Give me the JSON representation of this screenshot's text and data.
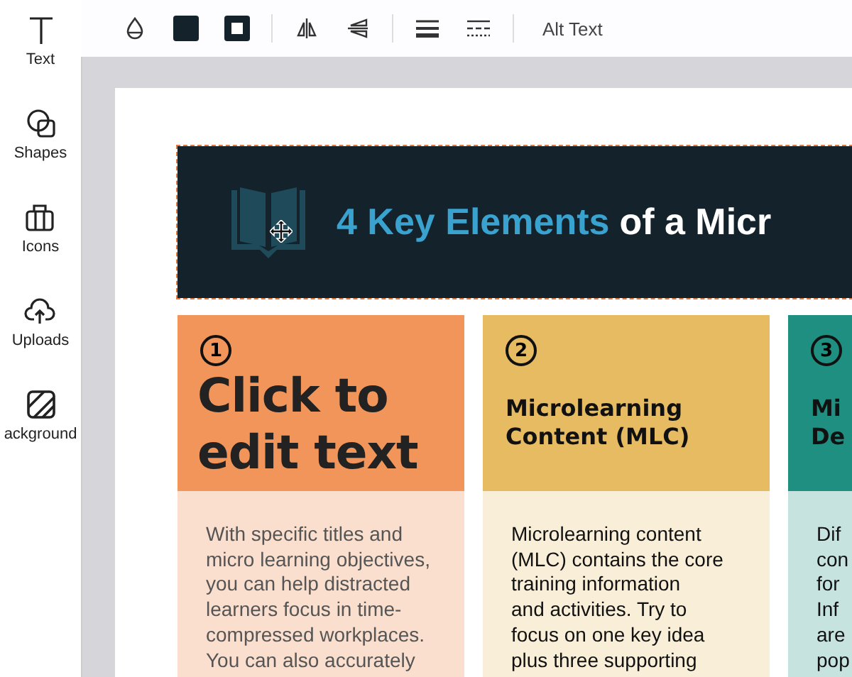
{
  "sidebar": {
    "items": [
      {
        "label": "Text",
        "kind": "text"
      },
      {
        "label": "Shapes",
        "kind": "shapes"
      },
      {
        "label": "Icons",
        "kind": "icons"
      },
      {
        "label": "Uploads",
        "kind": "uploads"
      },
      {
        "label": "ackground",
        "kind": "background"
      }
    ]
  },
  "toolbar": {
    "items": [
      {
        "kind": "opacity"
      },
      {
        "kind": "fill"
      },
      {
        "kind": "border"
      },
      {
        "kind": "divider"
      },
      {
        "kind": "flip-h"
      },
      {
        "kind": "flip-v"
      },
      {
        "kind": "divider"
      },
      {
        "kind": "line-weight"
      },
      {
        "kind": "line-style"
      },
      {
        "kind": "divider"
      },
      {
        "kind": "text",
        "label": "Alt Text"
      }
    ]
  },
  "canvas": {
    "header": {
      "title_highlight": "4 Key Elements",
      "title_rest": "of a Micr",
      "selected": true
    },
    "cards": [
      {
        "number": "1",
        "kind": "placeholder",
        "title": "Click to\nedit text",
        "color": "#f2955a",
        "body": "With specific titles and\nmicro learning objectives,\nyou can help distracted\nlearners focus in time-\ncompressed workplaces.\nYou can also accurately"
      },
      {
        "number": "2",
        "kind": "heading",
        "title": "Microlearning\nContent (MLC)",
        "color": "#e6bb62",
        "body": "Microlearning content\n(MLC) contains the core\ntraining information\nand activities. Try to\nfocus on one key idea\nplus three supporting"
      },
      {
        "number": "3",
        "kind": "heading",
        "title": "Mi\nDe",
        "color": "#1f8f82",
        "body": "Dif\ncon\nfor\nInf\nare\npop"
      }
    ]
  }
}
